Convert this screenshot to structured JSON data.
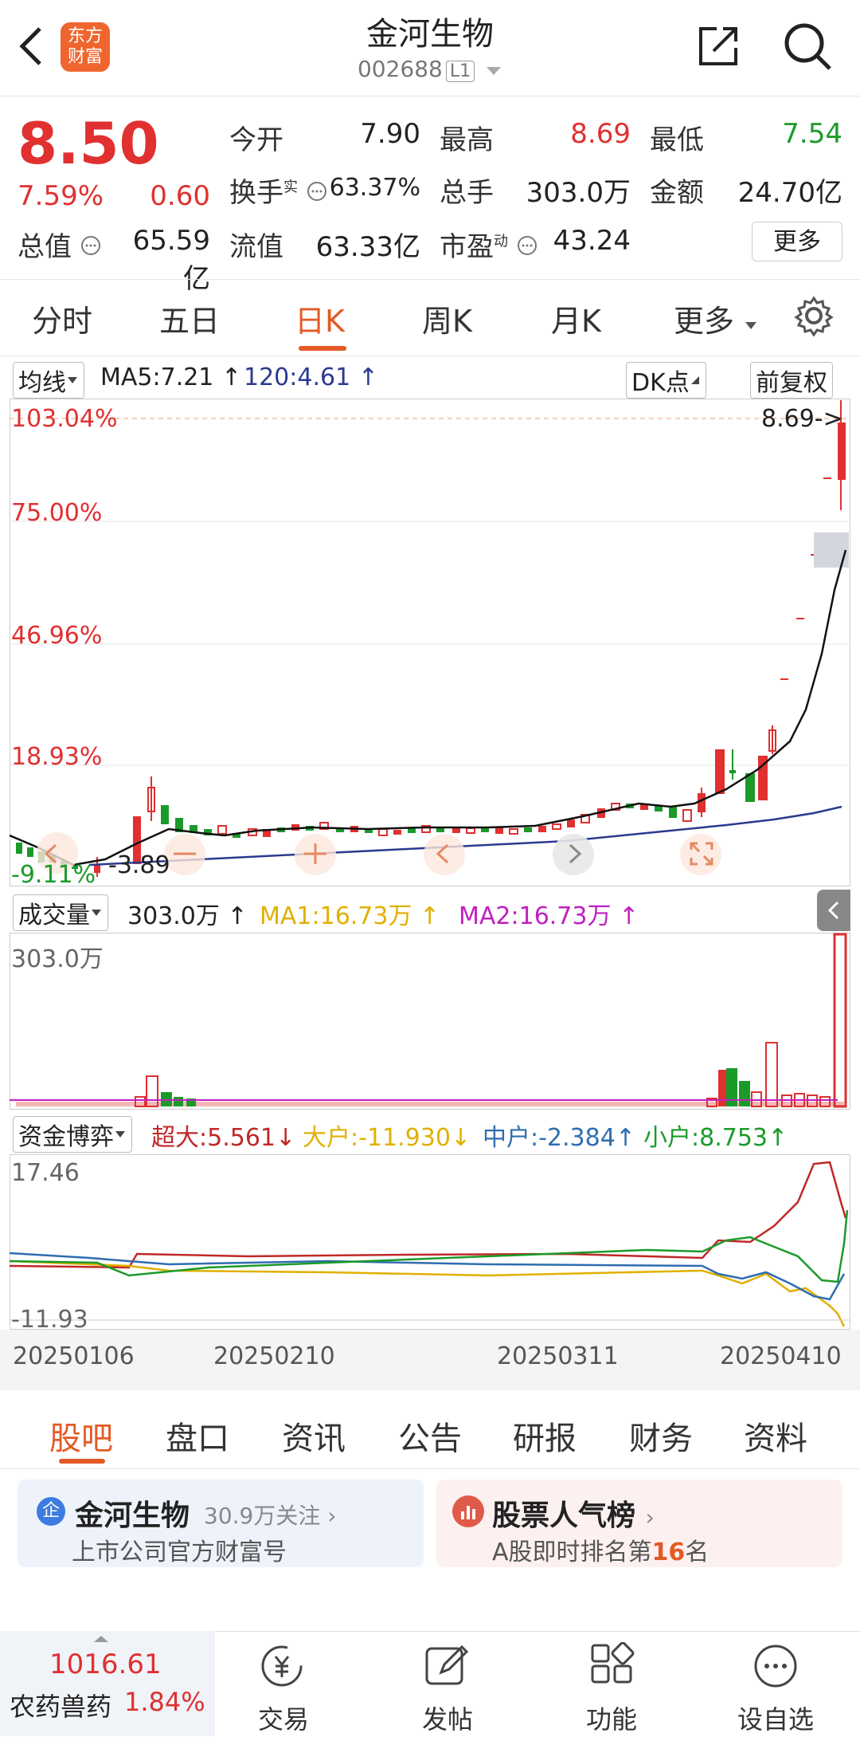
{
  "header": {
    "logo_text": "东方\n财富",
    "stock_name": "金河生物",
    "stock_code": "002688",
    "level": "L1"
  },
  "quote": {
    "price": "8.50",
    "change_pct": "7.59%",
    "change": "0.60",
    "open_label": "今开",
    "open": "7.90",
    "high_label": "最高",
    "high": "8.69",
    "low_label": "最低",
    "low": "7.54",
    "turnover_label": "换手",
    "turnover_sup": "实",
    "turnover": "63.37%",
    "volume_label": "总手",
    "volume": "303.0万",
    "amount_label": "金额",
    "amount": "24.70亿",
    "mktcap_label": "总值",
    "mktcap": "65.59亿",
    "float_label": "流值",
    "float": "63.33亿",
    "pe_label": "市盈",
    "pe_sup": "动",
    "pe": "43.24",
    "more": "更多"
  },
  "tabs": [
    "分时",
    "五日",
    "日K",
    "周K",
    "月K",
    "更多"
  ],
  "kchart": {
    "ma_selector": "均线",
    "ma5": "MA5:7.21",
    "ma120": "120:4.61",
    "dk_label": "DK点",
    "adjust_label": "前复权",
    "pct_labels": [
      "103.04%",
      "75.00%",
      "46.96%",
      "18.93%",
      "-9.11%"
    ],
    "last_price_marker": "8.69->",
    "low_marker": "3.89"
  },
  "volume": {
    "selector": "成交量",
    "value": "303.0万",
    "ma1": "MA1:16.73万",
    "ma2": "MA2:16.73万",
    "axis_top": "303.0万"
  },
  "fund": {
    "selector": "资金博弈",
    "super": "超大:5.561",
    "large": "大户:-11.930",
    "medium": "中户:-2.384",
    "small": "小户:8.753",
    "axis_top": "17.46",
    "axis_bottom": "-11.93",
    "dates": [
      "20250106",
      "20250210",
      "20250311",
      "20250410"
    ]
  },
  "bottom_tabs": [
    "股吧",
    "盘口",
    "资讯",
    "公告",
    "研报",
    "财务",
    "资料"
  ],
  "cards": {
    "left_badge": "企",
    "left_title": "金河生物",
    "left_follow": "30.9万关注",
    "left_sub": "上市公司官方财富号",
    "right_title": "股票人气榜",
    "right_sub_a": "A股即时排名第",
    "right_rank": "16",
    "right_sub_b": "名"
  },
  "nav": {
    "index_value": "1016.61",
    "index_name": "农药兽药",
    "index_pct": "1.84%",
    "items": [
      "交易",
      "发帖",
      "功能",
      "设自选"
    ]
  },
  "colors": {
    "up": "#e03030",
    "down": "#1b9a2a",
    "accent": "#e35a25",
    "ma120": "#2b3a8f"
  }
}
